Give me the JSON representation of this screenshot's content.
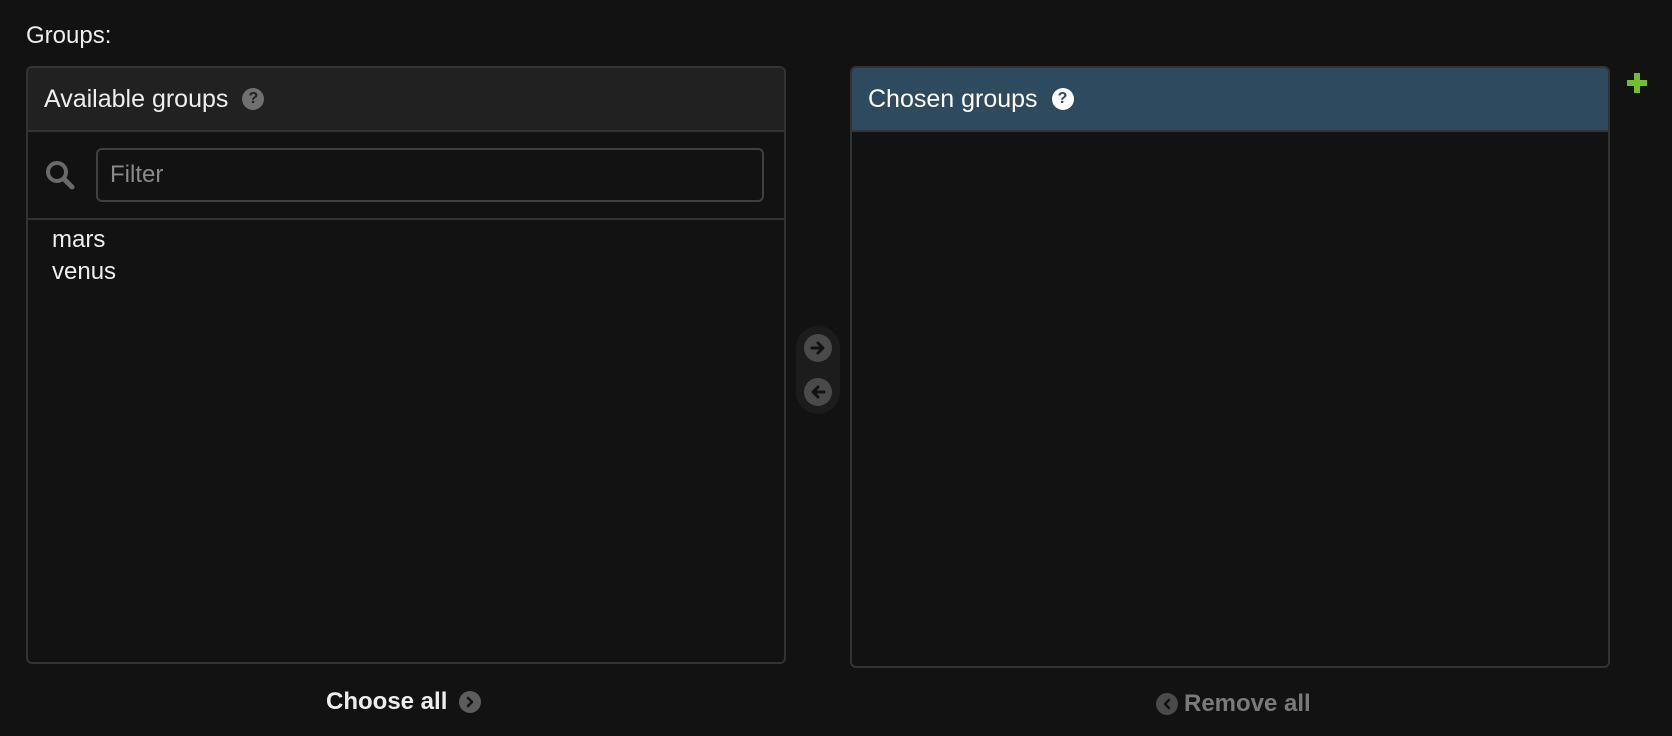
{
  "field": {
    "label": "Groups:"
  },
  "available": {
    "title": "Available groups",
    "help_icon": "question-circle-icon",
    "search_icon": "search-icon",
    "filter_placeholder": "Filter",
    "filter_value": "",
    "options": [
      "mars",
      "venus"
    ]
  },
  "chosen": {
    "title": "Chosen groups",
    "help_icon": "question-circle-icon",
    "options": []
  },
  "chooser": {
    "add_icon": "arrow-right-circle-icon",
    "remove_icon": "arrow-left-circle-icon"
  },
  "actions": {
    "choose_all_label": "Choose all",
    "remove_all_label": "Remove all",
    "add_related_icon": "plus-icon"
  },
  "colors": {
    "chosen_header_bg": "#2e4a5e",
    "add_icon": "#70bf2b",
    "background": "#121212"
  }
}
